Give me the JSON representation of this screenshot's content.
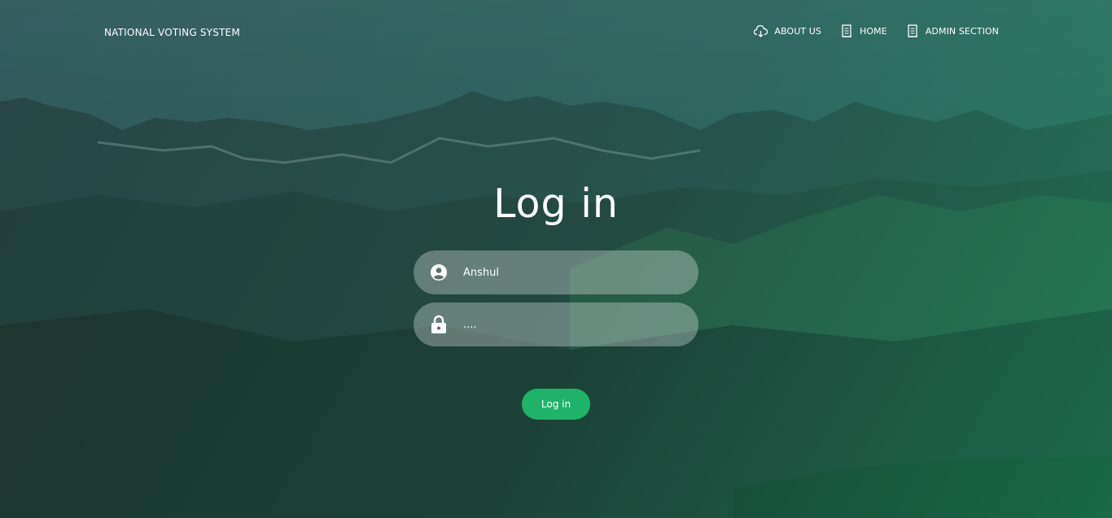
{
  "nav": {
    "brand": "NATIONAL VOTING SYSTEM",
    "links": [
      {
        "label": "ABOUT US",
        "icon": "cloud-download-icon"
      },
      {
        "label": "HOME",
        "icon": "document-icon"
      },
      {
        "label": "ADMIN SECTION",
        "icon": "document-icon"
      }
    ]
  },
  "login": {
    "title": "Log in",
    "username_value": "Anshul",
    "password_value": "....",
    "username_icon": "user-circle-icon",
    "password_icon": "lock-icon",
    "submit_label": "Log in"
  },
  "colors": {
    "accent": "#1fb36a",
    "text": "#ffffff"
  }
}
